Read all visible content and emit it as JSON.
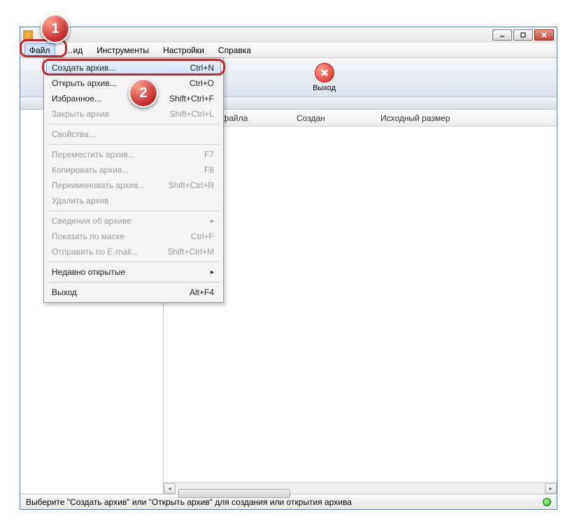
{
  "menubar": {
    "file": "Файл",
    "view": "…ид",
    "tools": "Инструменты",
    "settings": "Настройки",
    "help": "Справка"
  },
  "toolbar": {
    "exit_label": "Выход"
  },
  "columns": {
    "type": "Тип файла",
    "created": "Создан",
    "orig_size": "Исходный размер"
  },
  "dropdown": {
    "create": {
      "label": "Создать архив...",
      "shortcut": "Ctrl+N"
    },
    "open": {
      "label": "Открыть архив...",
      "shortcut": "Ctrl+O"
    },
    "fav": {
      "label": "Избранное...",
      "shortcut": "Shift+Ctrl+F"
    },
    "close": {
      "label": "Закрыть архив",
      "shortcut": "Shift+Ctrl+L"
    },
    "props": {
      "label": "Свойства...",
      "shortcut": ""
    },
    "move": {
      "label": "Переместить архив...",
      "shortcut": "F7"
    },
    "copy": {
      "label": "Копировать архив...",
      "shortcut": "F8"
    },
    "rename": {
      "label": "Переименовать архив...",
      "shortcut": "Shift+Ctrl+R"
    },
    "delete": {
      "label": "Удалить архив",
      "shortcut": ""
    },
    "info": {
      "label": "Сведения об архиве",
      "shortcut": ""
    },
    "mask": {
      "label": "Показать по маске",
      "shortcut": "Ctrl+F"
    },
    "email": {
      "label": "Отправить по E-mail...",
      "shortcut": "Shift+Ctrl+M"
    },
    "recent": {
      "label": "Недавно открытые",
      "shortcut": ""
    },
    "exit": {
      "label": "Выход",
      "shortcut": "Alt+F4"
    }
  },
  "statusbar": {
    "text": "Выберите \"Создать архив\" или \"Открыть архив\" для создания или открытия архива"
  },
  "callouts": {
    "one": "1",
    "two": "2"
  }
}
